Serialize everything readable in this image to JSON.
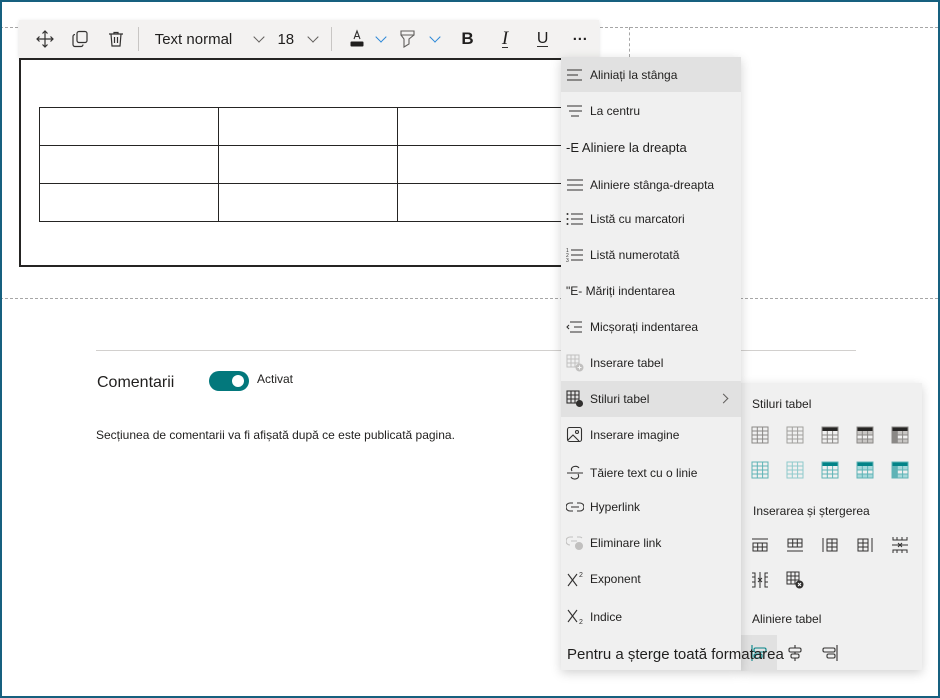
{
  "toolbar": {
    "icons": [
      "move-icon",
      "duplicate-icon",
      "delete-icon"
    ],
    "text_style": "Text normal",
    "font_size": "18",
    "font_color": "#201f1e",
    "bold_label": "B",
    "italic_label": "I",
    "underline_label": "U",
    "more_label": "···"
  },
  "table": {
    "rows": [
      [
        "",
        "",
        ""
      ],
      [
        "",
        "",
        ""
      ],
      [
        "",
        "",
        ""
      ]
    ]
  },
  "comments": {
    "label": "Comentarii",
    "toggle_state": "Activat",
    "toggle_on": true,
    "accent": "#03787c",
    "note": "Secțiunea de comentarii va fi afișată după ce este publicată pagina."
  },
  "menu": {
    "items": [
      {
        "label": "Aliniați la stânga",
        "icon": "align-left-icon"
      },
      {
        "label": "La centru",
        "icon": "align-center-icon"
      },
      {
        "label": "-E Aliniere la dreapta",
        "icon": "align-right-icon"
      },
      {
        "label": "Aliniere stânga-dreapta",
        "icon": "justify-icon"
      },
      {
        "label": "Listă cu marcatori",
        "icon": "bullet-list-icon"
      },
      {
        "label": "Listă numerotată",
        "icon": "numbered-list-icon"
      },
      {
        "label": "\"E- Măriți indentarea",
        "icon": "increase-indent-icon"
      },
      {
        "label": "Micșorați indentarea",
        "icon": "decrease-indent-icon"
      },
      {
        "label": "Inserare tabel",
        "icon": "insert-table-icon"
      },
      {
        "label": "Stiluri tabel",
        "icon": "table-styles-icon"
      },
      {
        "label": "Inserare imagine",
        "icon": "insert-image-icon"
      },
      {
        "label": "Tăiere text cu o linie",
        "icon": "strikethrough-icon"
      },
      {
        "label": "Hyperlink",
        "icon": "link-icon"
      },
      {
        "label": "Eliminare link",
        "icon": "remove-link-icon"
      },
      {
        "label": "Exponent",
        "icon": "superscript-icon"
      },
      {
        "label": "Indice",
        "icon": "subscript-icon"
      },
      {
        "label": "Pentru a șterge toată formatarea",
        "icon": "clear-formatting"
      }
    ]
  },
  "submenu": {
    "styles_heading": "Stiluri tabel",
    "insert_delete_heading": "Inserarea și ștergerea",
    "align_heading": "Aliniere tabel",
    "accent": "#038387"
  }
}
